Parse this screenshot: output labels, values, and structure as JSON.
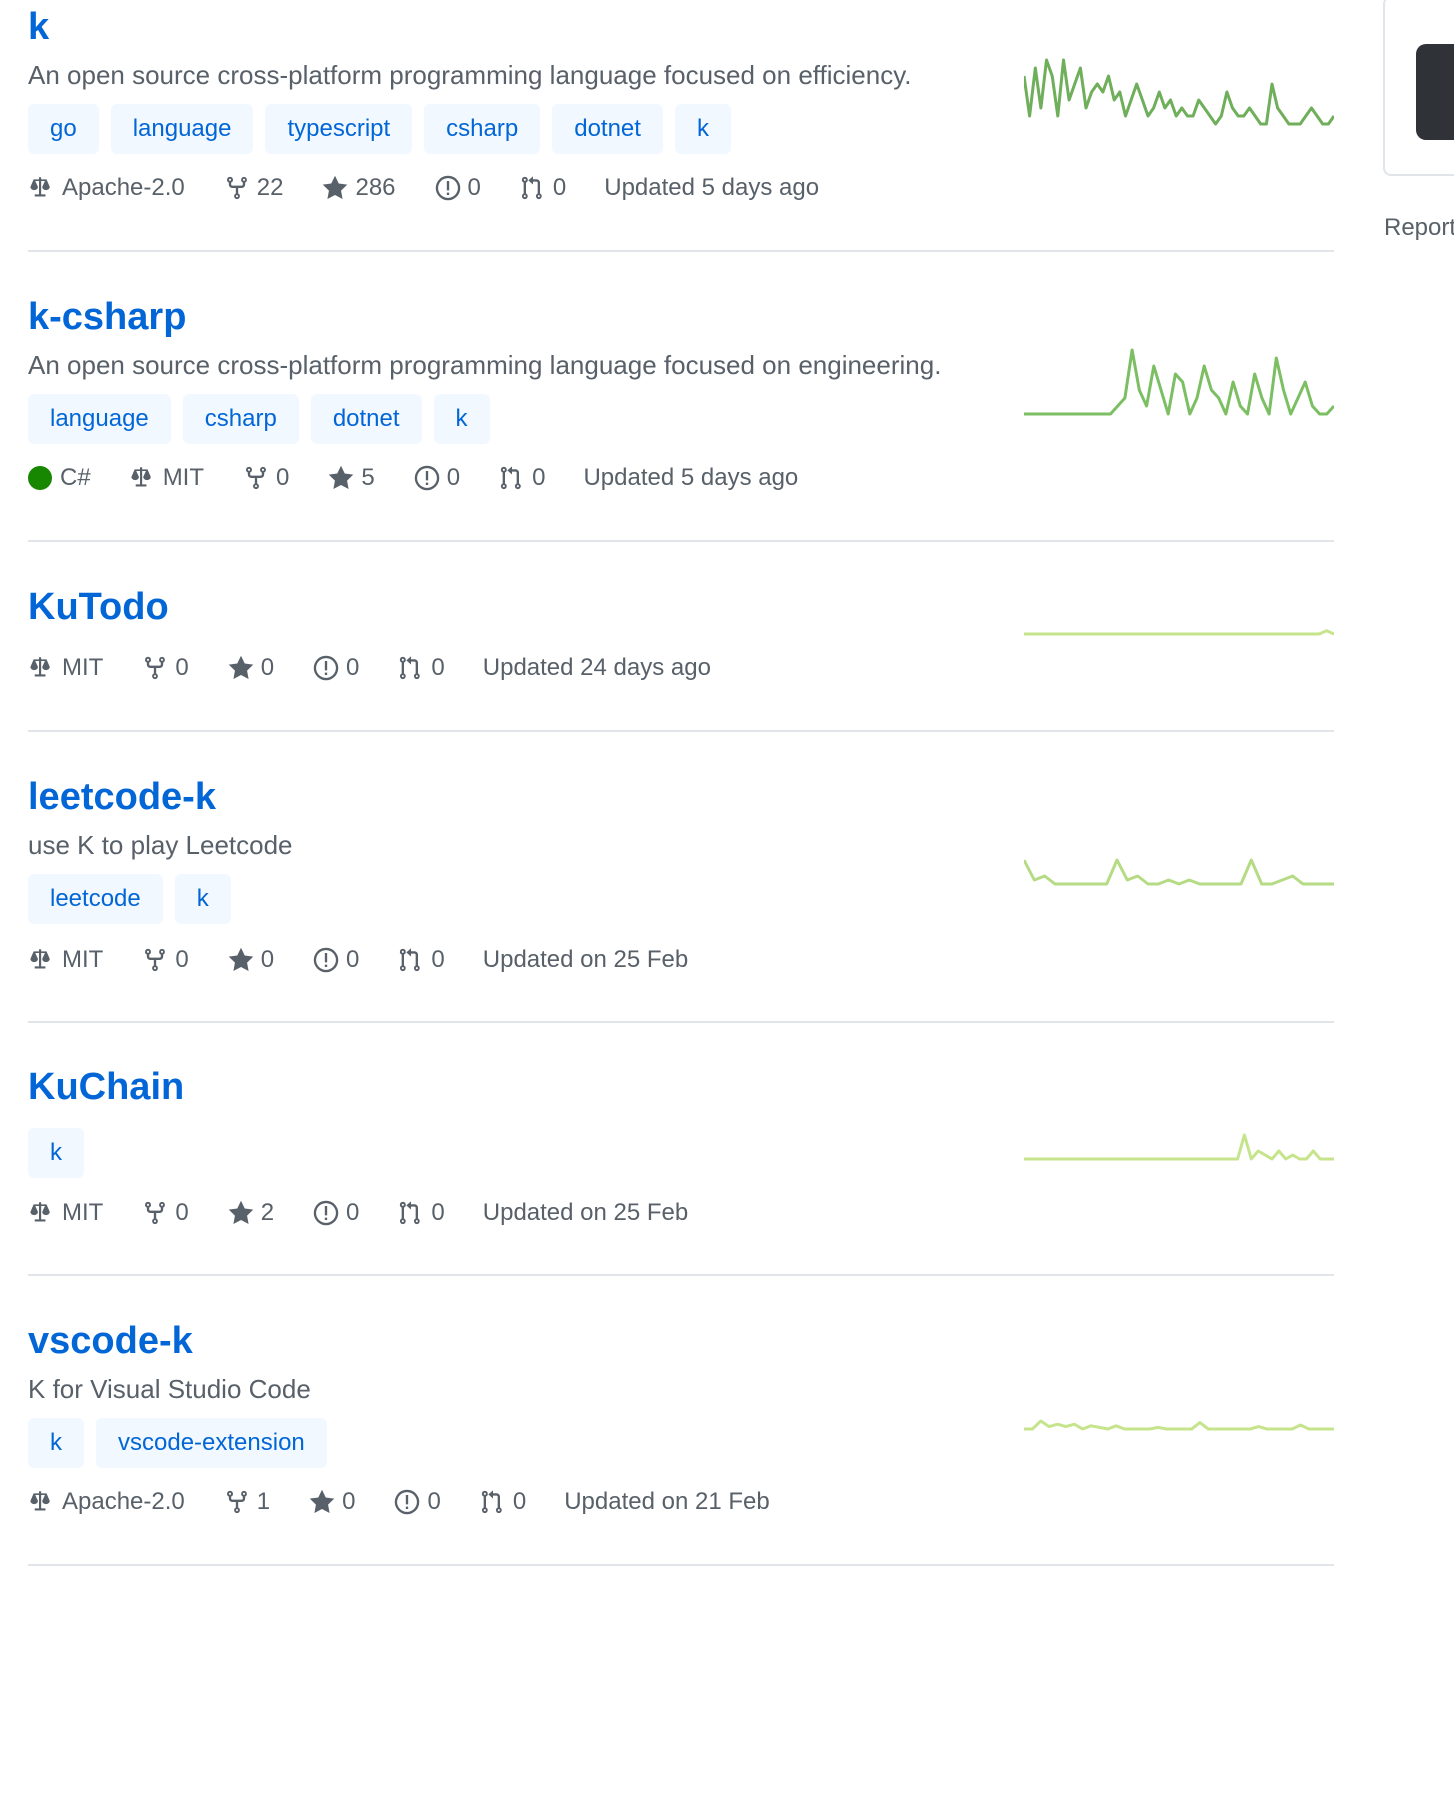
{
  "repos": [
    {
      "name": "k",
      "description": "An open source cross-platform programming language focused on efficiency.",
      "topics": [
        "go",
        "language",
        "typescript",
        "csharp",
        "dotnet",
        "k"
      ],
      "language": null,
      "license": "Apache-2.0",
      "forks": "22",
      "stars": "286",
      "issues": "0",
      "pull_requests": "0",
      "updated": "Updated 5 days ago",
      "spark_color": "#6fae5a",
      "activity": [
        6,
        1,
        7,
        2,
        8,
        6,
        1,
        8,
        3,
        5,
        7,
        2,
        4,
        5,
        4,
        6,
        3,
        4,
        1,
        3,
        5,
        3,
        1,
        2,
        4,
        2,
        3,
        1,
        2,
        1,
        1,
        3,
        2,
        1,
        0,
        1,
        4,
        2,
        1,
        1,
        2,
        1,
        0,
        0,
        5,
        2,
        1,
        0,
        0,
        0,
        1,
        2,
        1,
        0,
        0,
        1
      ]
    },
    {
      "name": "k-csharp",
      "description": "An open source cross-platform programming language focused on engineering.",
      "topics": [
        "language",
        "csharp",
        "dotnet",
        "k"
      ],
      "language": "C#",
      "language_color": "#178600",
      "license": "MIT",
      "forks": "0",
      "stars": "5",
      "issues": "0",
      "pull_requests": "0",
      "updated": "Updated 5 days ago",
      "spark_color": "#7cbf63",
      "activity": [
        0,
        0,
        0,
        0,
        0,
        0,
        0,
        0,
        0,
        0,
        0,
        0,
        0,
        1,
        2,
        8,
        3,
        1,
        6,
        3,
        0,
        5,
        4,
        0,
        2,
        6,
        3,
        2,
        0,
        4,
        1,
        0,
        5,
        2,
        0,
        7,
        3,
        0,
        2,
        4,
        1,
        0,
        0,
        1
      ]
    },
    {
      "name": "KuTodo",
      "description": "",
      "topics": [],
      "language": null,
      "license": "MIT",
      "forks": "0",
      "stars": "0",
      "issues": "0",
      "pull_requests": "0",
      "updated": "Updated 24 days ago",
      "spark_color": "#c6e48b",
      "activity": [
        0,
        0,
        0,
        0,
        0,
        0,
        0,
        0,
        0,
        0,
        0,
        0,
        0,
        0,
        0,
        0,
        0,
        0,
        0,
        0,
        0,
        0,
        0,
        0,
        0,
        0,
        0,
        0,
        0,
        0,
        0,
        0,
        0,
        0,
        0,
        0,
        0,
        0,
        0,
        0,
        0,
        0.4,
        0
      ]
    },
    {
      "name": "leetcode-k",
      "description": "use K to play Leetcode",
      "topics": [
        "leetcode",
        "k"
      ],
      "language": null,
      "license": "MIT",
      "forks": "0",
      "stars": "0",
      "issues": "0",
      "pull_requests": "0",
      "updated": "Updated on 25 Feb",
      "spark_color": "#b5db84",
      "activity": [
        3,
        0.5,
        1,
        0,
        0,
        0,
        0,
        0,
        0,
        3,
        0.5,
        1,
        0,
        0,
        0.5,
        0,
        0.5,
        0,
        0,
        0,
        0,
        0,
        3,
        0,
        0,
        0.5,
        1,
        0,
        0,
        0,
        0
      ]
    },
    {
      "name": "KuChain",
      "description": "",
      "topics": [
        "k"
      ],
      "language": null,
      "license": "MIT",
      "forks": "0",
      "stars": "2",
      "issues": "0",
      "pull_requests": "0",
      "updated": "Updated on 25 Feb",
      "spark_color": "#c6e48b",
      "activity": [
        0,
        0,
        0,
        0,
        0,
        0,
        0,
        0,
        0,
        0,
        0,
        0,
        0,
        0,
        0,
        0,
        0,
        0,
        0,
        0,
        0,
        0,
        0,
        0,
        0,
        0,
        0,
        0,
        0,
        0,
        0,
        0,
        3,
        0,
        1,
        0.5,
        0,
        1,
        0,
        0.5,
        0,
        0,
        1,
        0,
        0,
        0
      ]
    },
    {
      "name": "vscode-k",
      "description": "K for Visual Studio Code",
      "topics": [
        "k",
        "vscode-extension"
      ],
      "language": null,
      "license": "Apache-2.0",
      "forks": "1",
      "stars": "0",
      "issues": "0",
      "pull_requests": "0",
      "updated": "Updated on 21 Feb",
      "spark_color": "#c6e48b",
      "activity": [
        0,
        0,
        1,
        0.3,
        0.6,
        0.3,
        0.6,
        0,
        0.4,
        0.2,
        0,
        0.4,
        0,
        0,
        0,
        0,
        0.2,
        0,
        0,
        0,
        0,
        0.8,
        0,
        0,
        0,
        0,
        0,
        0,
        0.3,
        0,
        0,
        0,
        0,
        0.5,
        0,
        0,
        0,
        0
      ]
    }
  ],
  "sidebar": {
    "report": "Report"
  },
  "icons": {
    "license": "law-icon",
    "forks": "repo-forked-icon",
    "stars": "star-icon",
    "issues": "issue-opened-icon",
    "pull_requests": "git-pull-request-icon"
  }
}
